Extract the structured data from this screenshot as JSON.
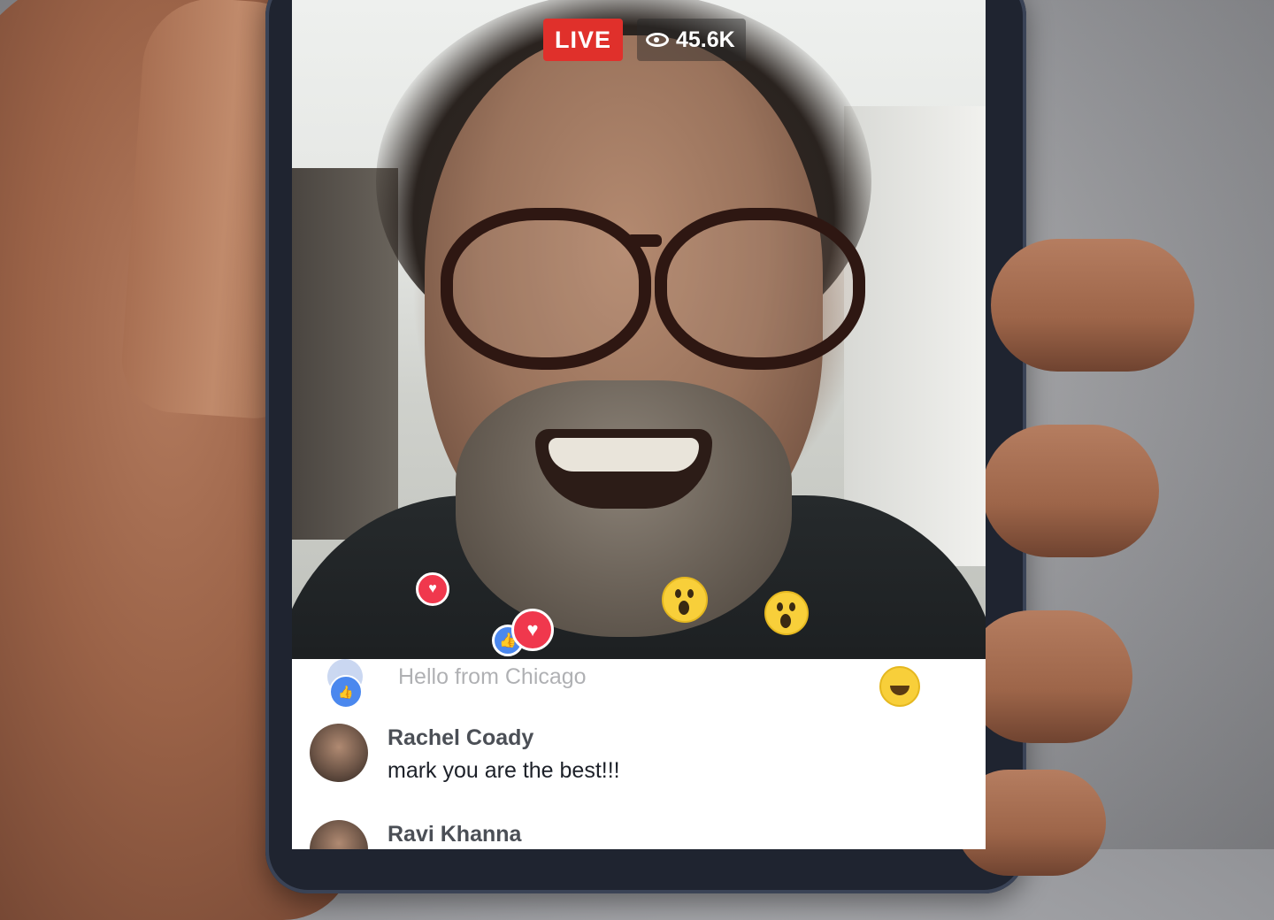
{
  "stream": {
    "live_label": "LIVE",
    "viewer_count": "45.6K"
  },
  "comments": [
    {
      "name": "",
      "text": "Hello from Chicago",
      "faded": true
    },
    {
      "name": "Rachel Coady",
      "text": "mark you are the best!!!"
    },
    {
      "name": "Ravi Khanna",
      "text": ""
    }
  ],
  "reactions": {
    "visible": [
      "heart",
      "wow",
      "wow",
      "like",
      "heart",
      "like",
      "haha"
    ]
  },
  "colors": {
    "live_red": "#e0302b",
    "heart": "#f0384d",
    "wow": "#f8cf3a",
    "like": "#4b88ee"
  }
}
